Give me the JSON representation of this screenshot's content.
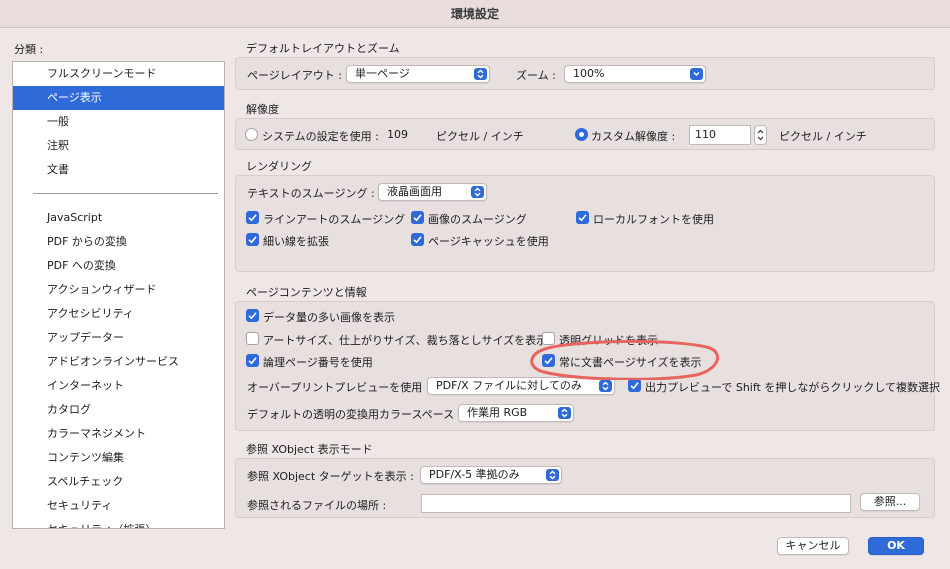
{
  "window": {
    "title": "環境設定"
  },
  "sidebar": {
    "label": "分類 :",
    "items_top": [
      "フルスクリーンモード",
      "ページ表示",
      "一般",
      "注釈",
      "文書"
    ],
    "selected_index": 1,
    "items_bottom": [
      "JavaScript",
      "PDF からの変換",
      "PDF への変換",
      "アクションウィザード",
      "アクセシビリティ",
      "アップデーター",
      "アドビオンラインサービス",
      "インターネット",
      "カタログ",
      "カラーマネジメント",
      "コンテンツ編集",
      "スペルチェック",
      "セキュリティ",
      "セキュリティ（拡張）"
    ]
  },
  "layout": {
    "title": "デフォルトレイアウトとズーム",
    "page_layout_label": "ページレイアウト :",
    "page_layout_value": "単一ページ",
    "zoom_label": "ズーム :",
    "zoom_value": "100%"
  },
  "resolution": {
    "title": "解像度",
    "system_label": "システムの設定を使用 :",
    "system_value": "109",
    "unit": "ピクセル / インチ",
    "custom_label": "カスタム解像度 :",
    "custom_value": "110",
    "selected": "custom"
  },
  "rendering": {
    "title": "レンダリング",
    "smoothing_label": "テキストのスムージング :",
    "smoothing_value": "液晶画面用",
    "line_art": {
      "label": "ラインアートのスムージング",
      "checked": true
    },
    "image_smoothing": {
      "label": "画像のスムージング",
      "checked": true
    },
    "local_fonts": {
      "label": "ローカルフォントを使用",
      "checked": true
    },
    "thin_lines": {
      "label": "細い線を拡張",
      "checked": true
    },
    "page_cache": {
      "label": "ページキャッシュを使用",
      "checked": true
    }
  },
  "content": {
    "title": "ページコンテンツと情報",
    "large_images": {
      "label": "データ量の多い画像を表示",
      "checked": true
    },
    "art_trim": {
      "label": "アートサイズ、仕上がりサイズ、裁ち落としサイズを表示",
      "checked": false
    },
    "transparency_grid": {
      "label": "透明グリッドを表示",
      "checked": false
    },
    "logical_page": {
      "label": "論理ページ番号を使用",
      "checked": true
    },
    "doc_page_size": {
      "label": "常に文書ページサイズを表示",
      "checked": true
    },
    "overprint_label": "オーバープリントプレビューを使用 :",
    "overprint_value": "PDF/X ファイルに対してのみ",
    "output_preview": {
      "label": "出力プレビューで Shift を押しながらクリックして複数選択",
      "checked": true
    },
    "blend_label": "デフォルトの透明の変換用カラースペース :",
    "blend_value": "作業用 RGB"
  },
  "xobject": {
    "title": "参照 XObject 表示モード",
    "target_label": "参照 XObject ターゲットを表示 :",
    "target_value": "PDF/X-5 準拠のみ",
    "location_label": "参照されるファイルの場所 :",
    "location_value": "",
    "browse_label": "参照..."
  },
  "footer": {
    "cancel_label": "キャンセル",
    "ok_label": "OK"
  },
  "colors": {
    "accent": "#2f6ad9",
    "annotation": "#e8645e",
    "background": "#efe6e6"
  }
}
